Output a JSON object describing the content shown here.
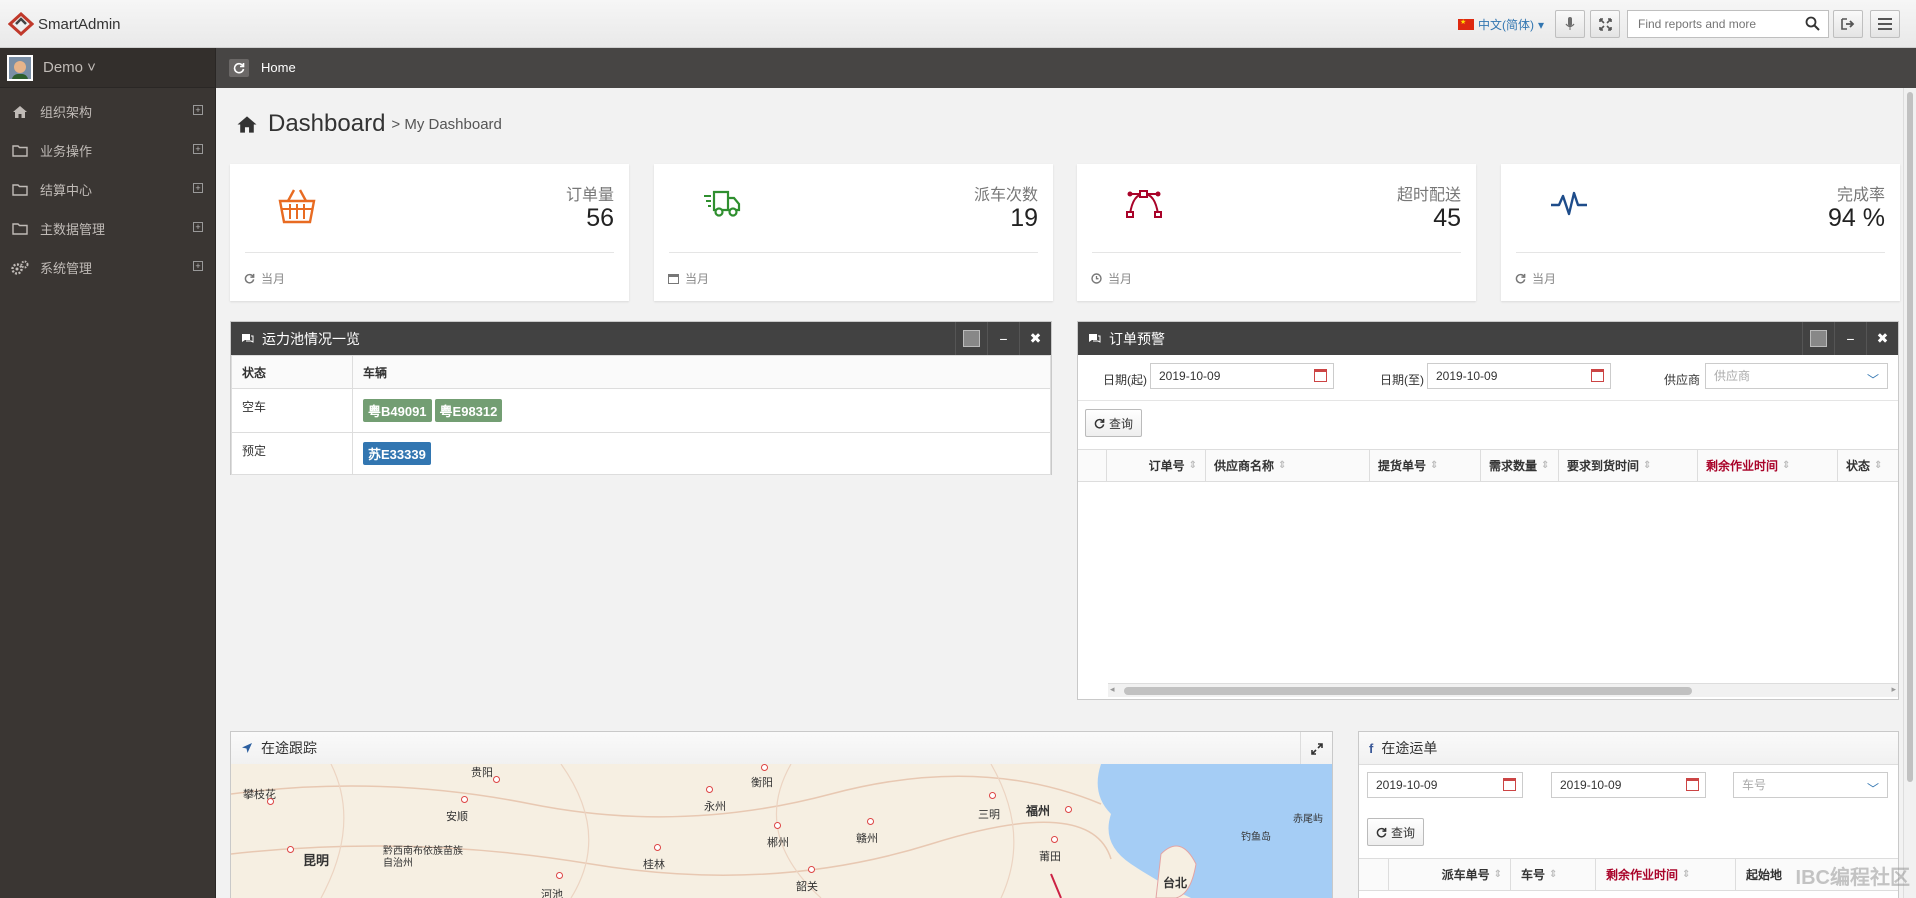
{
  "header": {
    "app_name": "SmartAdmin",
    "language": "中文(简体)",
    "search_placeholder": "Find reports and more"
  },
  "user": {
    "name": "Demo"
  },
  "sidebar": {
    "items": [
      {
        "label": "组织架构",
        "icon": "home-icon"
      },
      {
        "label": "业务操作",
        "icon": "folder-icon"
      },
      {
        "label": "结算中心",
        "icon": "folder-icon"
      },
      {
        "label": "主数据管理",
        "icon": "folder-icon"
      },
      {
        "label": "系统管理",
        "icon": "gears-icon"
      }
    ]
  },
  "ribbon": {
    "breadcrumb": "Home"
  },
  "page": {
    "title": "Dashboard",
    "subtitle": "> My Dashboard"
  },
  "stats": [
    {
      "label": "订单量",
      "value": "56",
      "footer": "当月",
      "icon": "basket-icon",
      "color": "#e86b22"
    },
    {
      "label": "派车次数",
      "value": "19",
      "footer": "当月",
      "icon": "truck-icon",
      "color": "#356e35"
    },
    {
      "label": "超时配送",
      "value": "45",
      "footer": "当月",
      "icon": "vector-icon",
      "color": "#a90329"
    },
    {
      "label": "完成率",
      "value": "94 %",
      "footer": "当月",
      "icon": "pulse-icon",
      "color": "#3276b1"
    }
  ],
  "capacity": {
    "title": "运力池情况一览",
    "columns": [
      "状态",
      "车辆"
    ],
    "rows": [
      {
        "status": "空车",
        "vehicles": [
          "粤B49091",
          "粤E98312"
        ],
        "color": "#739e73"
      },
      {
        "status": "预定",
        "vehicles": [
          "苏E33339"
        ],
        "color": "#3276b1"
      }
    ]
  },
  "order_alert": {
    "title": "订单预警",
    "date_from_label": "日期(起)",
    "date_from": "2019-10-09",
    "date_to_label": "日期(至)",
    "date_to": "2019-10-09",
    "supplier_label": "供应商",
    "supplier_placeholder": "供应商",
    "query_label": "查询",
    "columns": [
      "订单号",
      "供应商名称",
      "提货单号",
      "需求数量",
      "要求到货时间",
      "剩余作业时间",
      "状态"
    ]
  },
  "tracking": {
    "title": "在途跟踪",
    "cities": [
      "攀枝花",
      "昆明",
      "黔西南布依族苗族自治州",
      "安顺",
      "贵阳",
      "河池",
      "桂林",
      "永州",
      "衡阳",
      "郴州",
      "韶关",
      "赣州",
      "三明",
      "福州",
      "莆田",
      "台北",
      "钓鱼岛",
      "赤尾屿"
    ]
  },
  "transit": {
    "title": "在途运单",
    "date_from": "2019-10-09",
    "date_to": "2019-10-09",
    "vehicle_placeholder": "车号",
    "query_label": "查询",
    "columns": [
      "派车单号",
      "车号",
      "剩余作业时间",
      "起始地"
    ]
  },
  "watermark": "IBC编程社区"
}
